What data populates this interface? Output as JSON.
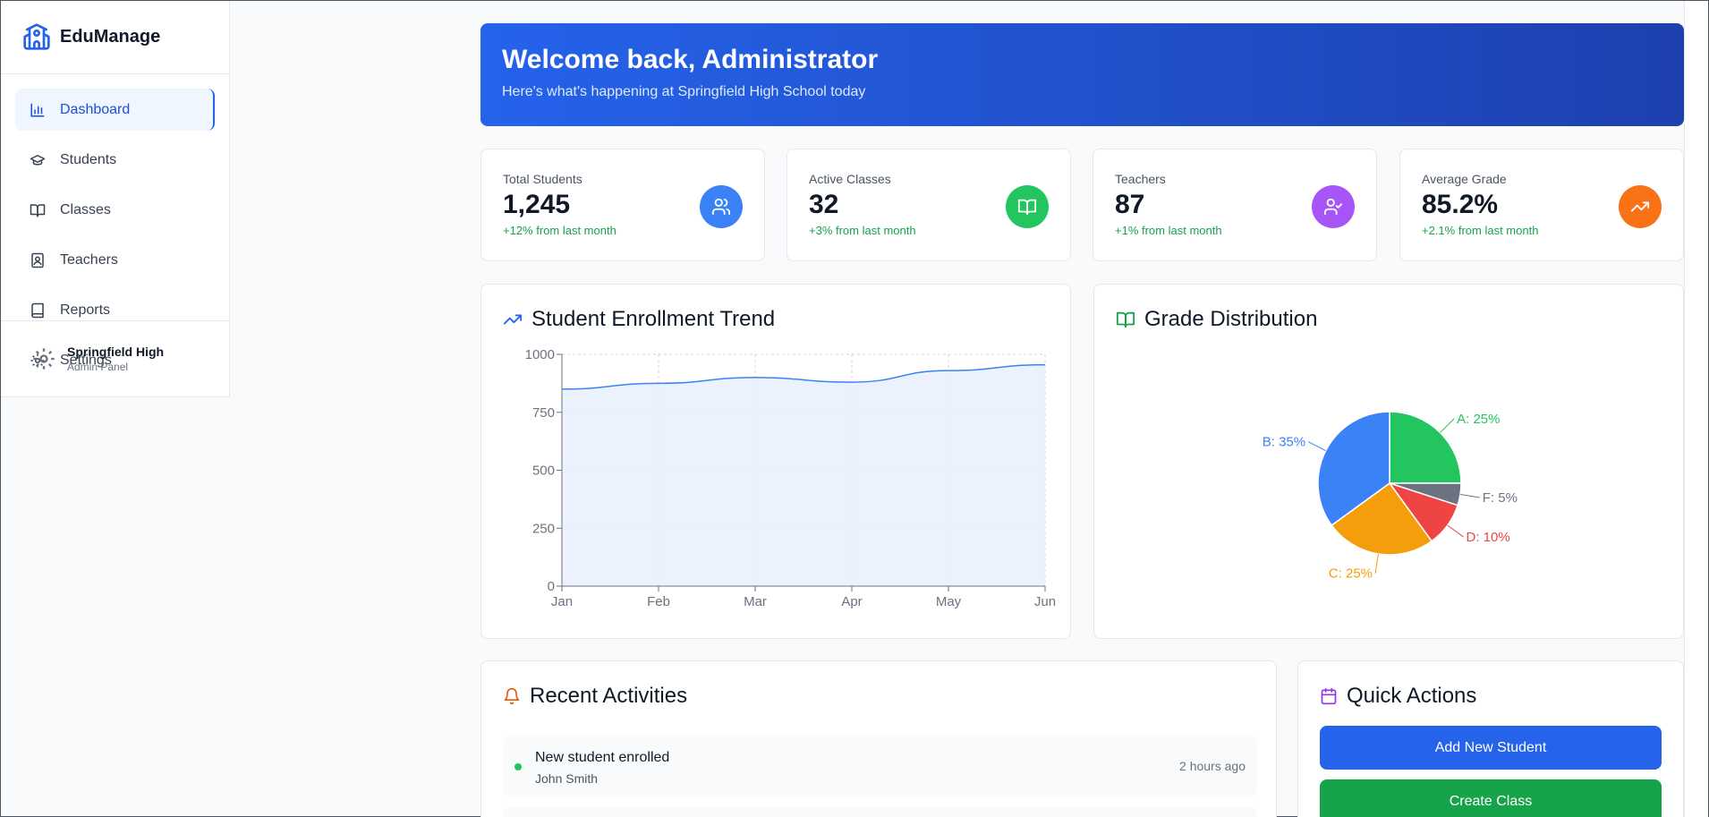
{
  "app": {
    "name": "EduManage"
  },
  "sidebar": {
    "items": [
      {
        "label": "Dashboard",
        "icon": "bar-chart-icon",
        "active": true
      },
      {
        "label": "Students",
        "icon": "graduation-cap-icon"
      },
      {
        "label": "Classes",
        "icon": "book-open-icon"
      },
      {
        "label": "Teachers",
        "icon": "contact-book-icon"
      },
      {
        "label": "Reports",
        "icon": "book-icon"
      },
      {
        "label": "Settings",
        "icon": "gear-icon"
      }
    ],
    "footer": {
      "name": "Springfield High",
      "subtitle": "Admin Panel",
      "icon": "gear-icon"
    }
  },
  "banner": {
    "title": "Welcome back, Administrator",
    "subtitle": "Here's what's happening at Springfield High School today"
  },
  "stats": [
    {
      "label": "Total Students",
      "value": "1,245",
      "change": "+12% from last month",
      "icon": "users-icon",
      "color": "#3b82f6"
    },
    {
      "label": "Active Classes",
      "value": "32",
      "change": "+3% from last month",
      "icon": "book-open-icon",
      "color": "#22c55e"
    },
    {
      "label": "Teachers",
      "value": "87",
      "change": "+1% from last month",
      "icon": "user-check-icon",
      "color": "#a855f7"
    },
    {
      "label": "Average Grade",
      "value": "85.2%",
      "change": "+2.1% from last month",
      "icon": "trending-up-icon",
      "color": "#f97316"
    }
  ],
  "enrollment": {
    "title": "Student Enrollment Trend",
    "icon": "trending-up-icon"
  },
  "grades": {
    "title": "Grade Distribution",
    "icon": "book-open-icon"
  },
  "activities": {
    "title": "Recent Activities",
    "icon": "bell-icon",
    "items": [
      {
        "title": "New student enrolled",
        "subtitle": "John Smith",
        "time": "2 hours ago"
      }
    ]
  },
  "quick_actions": {
    "title": "Quick Actions",
    "icon": "calendar-icon",
    "buttons": [
      {
        "label": "Add New Student",
        "color": "#2563eb"
      },
      {
        "label": "Create Class",
        "color": "#16a34a"
      }
    ]
  },
  "chart_data": [
    {
      "type": "area",
      "x": [
        "Jan",
        "Feb",
        "Mar",
        "Apr",
        "May",
        "Jun"
      ],
      "series": [
        {
          "values": [
            850,
            875,
            900,
            880,
            930,
            955
          ]
        }
      ],
      "ylim": [
        0,
        1000
      ],
      "yticks": [
        "0",
        "250",
        "500",
        "750",
        "1000"
      ],
      "grid": true,
      "colors": {
        "line": "#3b82f6",
        "fill": "#eaf1fd"
      }
    },
    {
      "type": "pie",
      "categories": [
        "A",
        "F",
        "D",
        "C",
        "B"
      ],
      "values": [
        25,
        5,
        10,
        25,
        35
      ],
      "labels": [
        "A: 25%",
        "F: 5%",
        "D: 10%",
        "C: 25%",
        "B: 35%"
      ],
      "colors": [
        "#22c55e",
        "#6b7280",
        "#ef4444",
        "#f59e0b",
        "#3b82f6"
      ]
    }
  ]
}
